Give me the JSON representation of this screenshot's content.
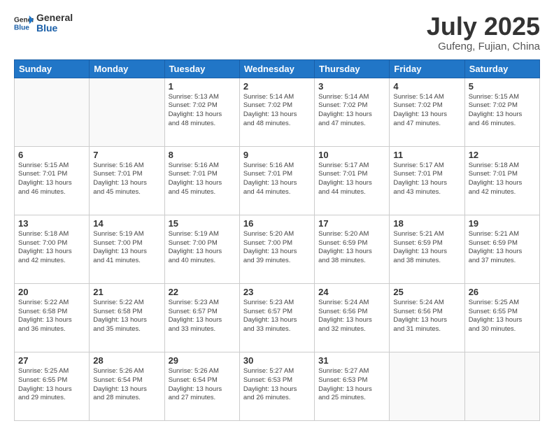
{
  "header": {
    "logo_general": "General",
    "logo_blue": "Blue",
    "month": "July 2025",
    "location": "Gufeng, Fujian, China"
  },
  "days_of_week": [
    "Sunday",
    "Monday",
    "Tuesday",
    "Wednesday",
    "Thursday",
    "Friday",
    "Saturday"
  ],
  "weeks": [
    [
      {
        "day": "",
        "info": ""
      },
      {
        "day": "",
        "info": ""
      },
      {
        "day": "1",
        "info": "Sunrise: 5:13 AM\nSunset: 7:02 PM\nDaylight: 13 hours\nand 48 minutes."
      },
      {
        "day": "2",
        "info": "Sunrise: 5:14 AM\nSunset: 7:02 PM\nDaylight: 13 hours\nand 48 minutes."
      },
      {
        "day": "3",
        "info": "Sunrise: 5:14 AM\nSunset: 7:02 PM\nDaylight: 13 hours\nand 47 minutes."
      },
      {
        "day": "4",
        "info": "Sunrise: 5:14 AM\nSunset: 7:02 PM\nDaylight: 13 hours\nand 47 minutes."
      },
      {
        "day": "5",
        "info": "Sunrise: 5:15 AM\nSunset: 7:02 PM\nDaylight: 13 hours\nand 46 minutes."
      }
    ],
    [
      {
        "day": "6",
        "info": "Sunrise: 5:15 AM\nSunset: 7:01 PM\nDaylight: 13 hours\nand 46 minutes."
      },
      {
        "day": "7",
        "info": "Sunrise: 5:16 AM\nSunset: 7:01 PM\nDaylight: 13 hours\nand 45 minutes."
      },
      {
        "day": "8",
        "info": "Sunrise: 5:16 AM\nSunset: 7:01 PM\nDaylight: 13 hours\nand 45 minutes."
      },
      {
        "day": "9",
        "info": "Sunrise: 5:16 AM\nSunset: 7:01 PM\nDaylight: 13 hours\nand 44 minutes."
      },
      {
        "day": "10",
        "info": "Sunrise: 5:17 AM\nSunset: 7:01 PM\nDaylight: 13 hours\nand 44 minutes."
      },
      {
        "day": "11",
        "info": "Sunrise: 5:17 AM\nSunset: 7:01 PM\nDaylight: 13 hours\nand 43 minutes."
      },
      {
        "day": "12",
        "info": "Sunrise: 5:18 AM\nSunset: 7:01 PM\nDaylight: 13 hours\nand 42 minutes."
      }
    ],
    [
      {
        "day": "13",
        "info": "Sunrise: 5:18 AM\nSunset: 7:00 PM\nDaylight: 13 hours\nand 42 minutes."
      },
      {
        "day": "14",
        "info": "Sunrise: 5:19 AM\nSunset: 7:00 PM\nDaylight: 13 hours\nand 41 minutes."
      },
      {
        "day": "15",
        "info": "Sunrise: 5:19 AM\nSunset: 7:00 PM\nDaylight: 13 hours\nand 40 minutes."
      },
      {
        "day": "16",
        "info": "Sunrise: 5:20 AM\nSunset: 7:00 PM\nDaylight: 13 hours\nand 39 minutes."
      },
      {
        "day": "17",
        "info": "Sunrise: 5:20 AM\nSunset: 6:59 PM\nDaylight: 13 hours\nand 38 minutes."
      },
      {
        "day": "18",
        "info": "Sunrise: 5:21 AM\nSunset: 6:59 PM\nDaylight: 13 hours\nand 38 minutes."
      },
      {
        "day": "19",
        "info": "Sunrise: 5:21 AM\nSunset: 6:59 PM\nDaylight: 13 hours\nand 37 minutes."
      }
    ],
    [
      {
        "day": "20",
        "info": "Sunrise: 5:22 AM\nSunset: 6:58 PM\nDaylight: 13 hours\nand 36 minutes."
      },
      {
        "day": "21",
        "info": "Sunrise: 5:22 AM\nSunset: 6:58 PM\nDaylight: 13 hours\nand 35 minutes."
      },
      {
        "day": "22",
        "info": "Sunrise: 5:23 AM\nSunset: 6:57 PM\nDaylight: 13 hours\nand 33 minutes."
      },
      {
        "day": "23",
        "info": "Sunrise: 5:23 AM\nSunset: 6:57 PM\nDaylight: 13 hours\nand 33 minutes."
      },
      {
        "day": "24",
        "info": "Sunrise: 5:24 AM\nSunset: 6:56 PM\nDaylight: 13 hours\nand 32 minutes."
      },
      {
        "day": "25",
        "info": "Sunrise: 5:24 AM\nSunset: 6:56 PM\nDaylight: 13 hours\nand 31 minutes."
      },
      {
        "day": "26",
        "info": "Sunrise: 5:25 AM\nSunset: 6:55 PM\nDaylight: 13 hours\nand 30 minutes."
      }
    ],
    [
      {
        "day": "27",
        "info": "Sunrise: 5:25 AM\nSunset: 6:55 PM\nDaylight: 13 hours\nand 29 minutes."
      },
      {
        "day": "28",
        "info": "Sunrise: 5:26 AM\nSunset: 6:54 PM\nDaylight: 13 hours\nand 28 minutes."
      },
      {
        "day": "29",
        "info": "Sunrise: 5:26 AM\nSunset: 6:54 PM\nDaylight: 13 hours\nand 27 minutes."
      },
      {
        "day": "30",
        "info": "Sunrise: 5:27 AM\nSunset: 6:53 PM\nDaylight: 13 hours\nand 26 minutes."
      },
      {
        "day": "31",
        "info": "Sunrise: 5:27 AM\nSunset: 6:53 PM\nDaylight: 13 hours\nand 25 minutes."
      },
      {
        "day": "",
        "info": ""
      },
      {
        "day": "",
        "info": ""
      }
    ]
  ]
}
